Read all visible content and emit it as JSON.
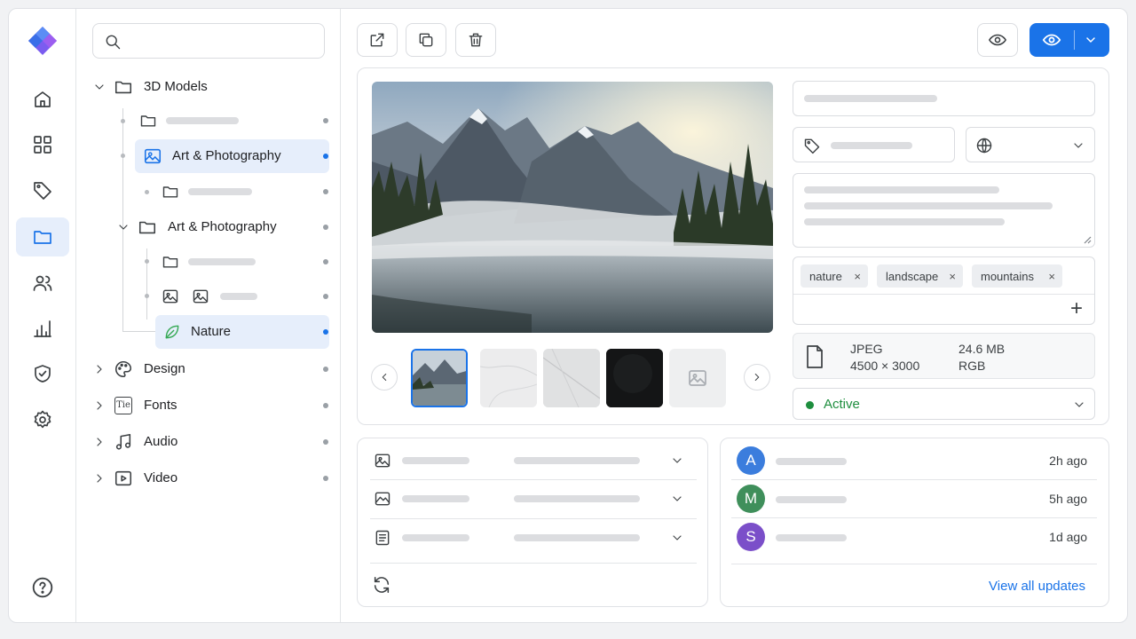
{
  "search": {
    "placeholder": ""
  },
  "tree": {
    "items": [
      {
        "label": "3D Models"
      },
      {
        "label": "Art & Photography"
      },
      {
        "label": "Art & Photography"
      },
      {
        "label": "Nature"
      },
      {
        "label": "Design"
      },
      {
        "label": "Fonts"
      },
      {
        "label": "Audio"
      },
      {
        "label": "Video"
      }
    ]
  },
  "tags": [
    "nature",
    "landscape",
    "mountains"
  ],
  "file": {
    "format": "JPEG",
    "dimensions": "4500 × 3000",
    "size": "24.6 MB",
    "color_mode": "RGB"
  },
  "status": {
    "label": "Active",
    "color": "#1e8e3e"
  },
  "updates": [
    {
      "initial": "A",
      "time": "2h ago",
      "color": "#3b7ddd"
    },
    {
      "initial": "M",
      "time": "5h ago",
      "color": "#3f8f5b"
    },
    {
      "initial": "S",
      "time": "1d ago",
      "color": "#7b4fc9"
    }
  ],
  "view_all_label": "View all updates",
  "icon_names": {
    "tag_icon": "×",
    "add_tag": "+"
  },
  "accent_color": "#1a73e8"
}
